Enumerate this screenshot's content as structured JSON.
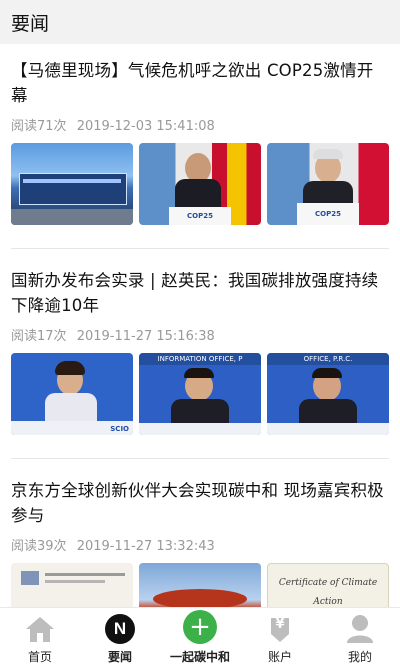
{
  "header": {
    "title": "要闻"
  },
  "articles": [
    {
      "title": "【马德里现场】气候危机呼之欲出 COP25激情开幕",
      "views": "阅读71次",
      "datetime": "2019-12-03 15:41:08",
      "thumb_captions": [
        "",
        "COP25",
        "COP25"
      ]
    },
    {
      "title": "国新办发布会实录 | 赵英民：我国碳排放强度持续下降逾10年",
      "views": "阅读17次",
      "datetime": "2019-11-27 15:16:38",
      "thumb_captions": [
        "SCIO",
        "INFORMATION OFFICE, P",
        "OFFICE, P.R.C."
      ]
    },
    {
      "title": "京东方全球创新伙伴大会实现碳中和 现场嘉宾积极参与",
      "views": "阅读39次",
      "datetime": "2019-11-27 13:32:43",
      "thumb_captions": [
        "",
        "",
        "Certificate of Climate Action"
      ]
    }
  ],
  "tabbar": {
    "items": [
      {
        "label": "首页",
        "icon": "home-icon"
      },
      {
        "label": "要闻",
        "icon": "news-n-icon",
        "glyph": "N"
      },
      {
        "label": "一起碳中和",
        "icon": "plus-icon",
        "glyph": "+"
      },
      {
        "label": "账户",
        "icon": "yen-icon",
        "glyph": "¥"
      },
      {
        "label": "我的",
        "icon": "user-icon"
      }
    ]
  },
  "colors": {
    "header_bg": "#f2f2f2",
    "plus_green": "#3cb14a",
    "meta_gray": "#999999",
    "icon_gray": "#bdbdbd"
  }
}
